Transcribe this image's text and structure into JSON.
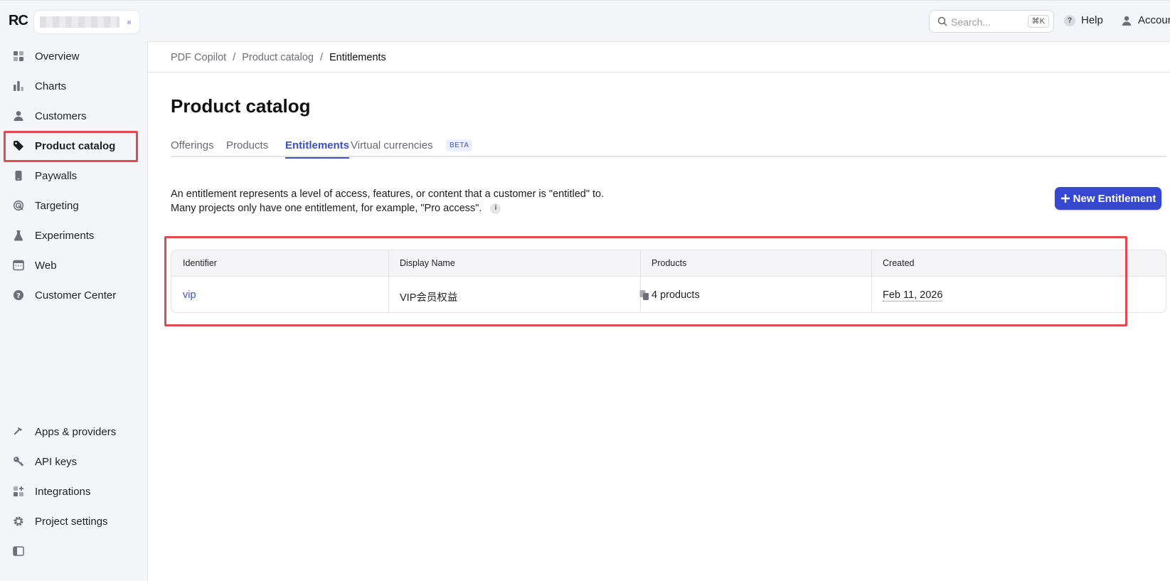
{
  "app": {
    "logo_text": "RC"
  },
  "topbar": {
    "search_placeholder": "Search...",
    "search_shortcut": "⌘K",
    "help_label": "Help",
    "account_label": "Account"
  },
  "sidebar": {
    "items": [
      {
        "label": "Overview",
        "icon": "grid-icon"
      },
      {
        "label": "Charts",
        "icon": "bar-chart-icon"
      },
      {
        "label": "Customers",
        "icon": "user-icon"
      },
      {
        "label": "Product catalog",
        "icon": "tag-icon"
      },
      {
        "label": "Paywalls",
        "icon": "phone-icon"
      },
      {
        "label": "Targeting",
        "icon": "target-icon"
      },
      {
        "label": "Experiments",
        "icon": "flask-icon"
      },
      {
        "label": "Web",
        "icon": "browser-icon"
      },
      {
        "label": "Customer Center",
        "icon": "question-icon"
      }
    ],
    "bottom_items": [
      {
        "label": "Apps & providers",
        "icon": "hammer-icon"
      },
      {
        "label": "API keys",
        "icon": "key-icon"
      },
      {
        "label": "Integrations",
        "icon": "plus-grid-icon"
      },
      {
        "label": "Project settings",
        "icon": "gear-icon"
      }
    ]
  },
  "breadcrumb": {
    "items": [
      "PDF Copilot",
      "Product catalog",
      "Entitlements"
    ],
    "separator": "/"
  },
  "page": {
    "title": "Product catalog"
  },
  "tabs": [
    {
      "label": "Offerings"
    },
    {
      "label": "Products"
    },
    {
      "label": "Entitlements",
      "active": true
    },
    {
      "label": "Virtual currencies",
      "badge": "BETA"
    }
  ],
  "description": {
    "line1": "An entitlement represents a level of access, features, or content that a customer is \"entitled\" to.",
    "line2": "Many projects only have one entitlement, for example, \"Pro access\"."
  },
  "actions": {
    "new_entitlement": "New Entitlement"
  },
  "table": {
    "headers": [
      "Identifier",
      "Display Name",
      "Products",
      "Created"
    ],
    "rows": [
      {
        "identifier": "vip",
        "display_name": "VIP会员权益",
        "products": "4 products",
        "created": "Feb 11, 2026"
      }
    ]
  },
  "colors": {
    "accent": "#3647d1",
    "link": "#3b50d6",
    "highlight": "#e5484d"
  }
}
